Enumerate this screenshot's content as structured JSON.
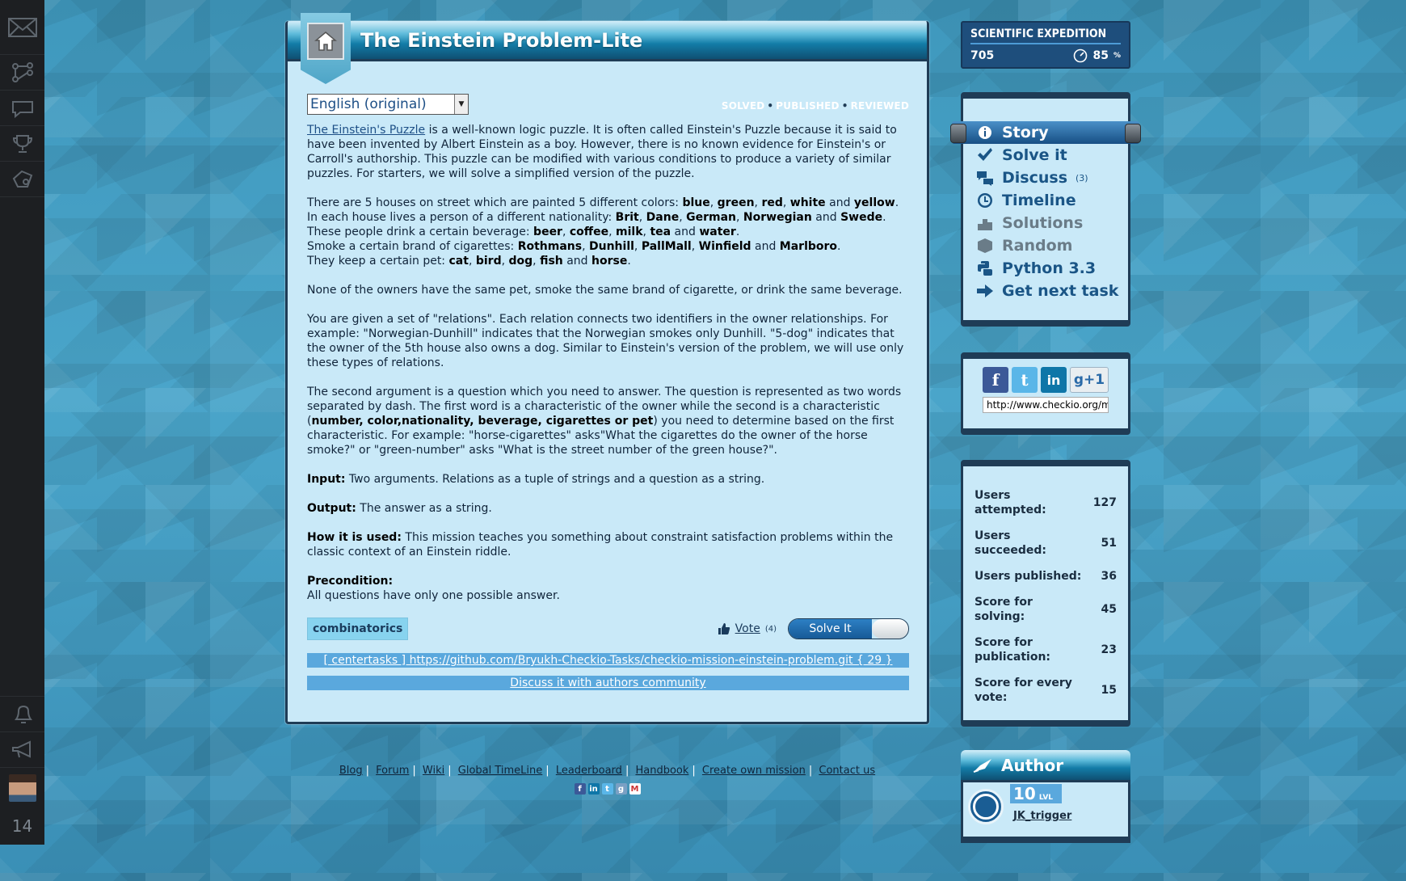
{
  "rail": {
    "icons": [
      "mail-logo-icon",
      "tree-icon",
      "chat-icon",
      "trophy-icon",
      "tag-icon"
    ],
    "bottom_icons": [
      "bell-icon",
      "megaphone-icon"
    ],
    "count": "14"
  },
  "main": {
    "title": "The Einstein Problem-Lite",
    "language": "English (original)",
    "status": [
      "SOLVED",
      "PUBLISHED",
      "REVIEWED"
    ],
    "story": {
      "p1_link": "The Einstein's Puzzle",
      "p1_rest": " is a well-known logic puzzle. It is often called Einstein's Puzzle because it is said to have been invented by Albert Einstein as a boy. However, there is no known evidence for Einstein's or Carroll's authorship. This puzzle can be modified with various conditions to produce a variety of similar puzzles. For starters, we will solve a simplified version of the puzzle.",
      "p2_l1_a": "There are 5 houses on street which are painted 5 different colors: ",
      "p2_l1_colors": [
        "blue",
        "green",
        "red",
        "white"
      ],
      "p2_l1_last": "yellow",
      "p2_l2_a": "In each house lives a person of a different nationality: ",
      "p2_l2_items": [
        "Brit",
        "Dane",
        "German",
        "Norwegian"
      ],
      "p2_l2_last": "Swede",
      "p2_l3_a": "These people drink a certain beverage: ",
      "p2_l3_items": [
        "beer",
        "coffee",
        "milk",
        "tea"
      ],
      "p2_l3_last": "water",
      "p2_l4_a": "Smoke a certain brand of cigarettes: ",
      "p2_l4_items": [
        "Rothmans",
        "Dunhill",
        "PallMall",
        "Winfield"
      ],
      "p2_l4_last": "Marlboro",
      "p2_l5_a": "They keep a certain pet: ",
      "p2_l5_items": [
        "cat",
        "bird",
        "dog",
        "fish"
      ],
      "p2_l5_last": "horse",
      "p3": "None of the owners have the same pet, smoke the same brand of cigarette, or drink the same beverage.",
      "p4": "You are given a set of \"relations\". Each relation connects two identifiers in the owner relationships. For example: \"Norwegian-Dunhill\" indicates that the Norwegian smokes only Dunhill. \"5-dog\" indicates that the owner of the 5th house also owns a dog. Similar to Einstein's version of the problem, we will use only these types of relations.",
      "p5_a": "The second argument is a question which you need to answer. The question is represented as two words separated by dash. The first word is a characteristic of the owner while the second is a characteristic (",
      "p5_b": "number, color,nationality, beverage, cigarettes or pet",
      "p5_c": ") you need to determine based on the first characteristic. For example: \"horse-cigarettes\" asks\"What the cigarettes do the owner of the horse smoke?\" or \"green-number\" asks \"What is the street number of the green house?\".",
      "input_label": "Input:",
      "input_text": " Two arguments. Relations as a tuple of strings and a question as a string.",
      "output_label": "Output:",
      "output_text": " The answer as a string.",
      "how_label": "How it is used:",
      "how_text": " This mission teaches you something about constraint satisfaction problems within the classic context of an Einstein riddle.",
      "pre_label": "Precondition:",
      "pre_text": "All questions have only one possible answer."
    },
    "tag": "combinatorics",
    "vote_label": "Vote",
    "vote_count": "(4)",
    "solve_label": "Solve It",
    "repo_link": "[ centertasks ] https://github.com/Bryukh-Checkio-Tasks/checkio-mission-einstein-problem.git { 29 }",
    "discuss_link": "Discuss it with authors community"
  },
  "expedition": {
    "title": "SCIENTIFIC EXPEDITION",
    "score": "705",
    "percent": "85",
    "percent_unit": "%"
  },
  "nav": [
    {
      "label": "Story",
      "icon": "info-icon",
      "active": true,
      "muted": false,
      "sup": ""
    },
    {
      "label": "Solve it",
      "icon": "check-icon",
      "active": false,
      "muted": false,
      "sup": ""
    },
    {
      "label": "Discuss",
      "icon": "chat-bubbles-icon",
      "active": false,
      "muted": false,
      "sup": "(3)"
    },
    {
      "label": "Timeline",
      "icon": "clock-icon",
      "active": false,
      "muted": false,
      "sup": ""
    },
    {
      "label": "Solutions",
      "icon": "podium-icon",
      "active": false,
      "muted": true,
      "sup": ""
    },
    {
      "label": "Random",
      "icon": "box-icon",
      "active": false,
      "muted": true,
      "sup": ""
    },
    {
      "label": "Python 3.3",
      "icon": "python-icon",
      "active": false,
      "muted": false,
      "sup": ""
    },
    {
      "label": "Get next task",
      "icon": "arrow-right-icon",
      "active": false,
      "muted": false,
      "sup": ""
    }
  ],
  "share": {
    "url": "http://www.checkio.org/mission/einstein-problem/",
    "gplus": "g+1"
  },
  "stats": [
    {
      "label": "Users attempted:",
      "value": "127"
    },
    {
      "label": "Users succeeded:",
      "value": "51"
    },
    {
      "label": "Users published:",
      "value": "36"
    },
    {
      "label": "Score for solving:",
      "value": "45"
    },
    {
      "label": "Score for publication:",
      "value": "23"
    },
    {
      "label": "Score for every vote:",
      "value": "15"
    }
  ],
  "author": {
    "title": "Author",
    "level": "10",
    "level_unit": "LVL",
    "name": "JK_trigger"
  },
  "footer": {
    "links": [
      "Blog",
      "Forum",
      "Wiki",
      "Global TimeLine",
      "Leaderboard",
      "Handbook",
      "Create own mission",
      "Contact us"
    ]
  },
  "colors": {
    "panel_bg": "#c9e9f8",
    "panel_border": "#1f3c56",
    "accent": "#1a5586",
    "link_bar": "#5aa8dd"
  }
}
